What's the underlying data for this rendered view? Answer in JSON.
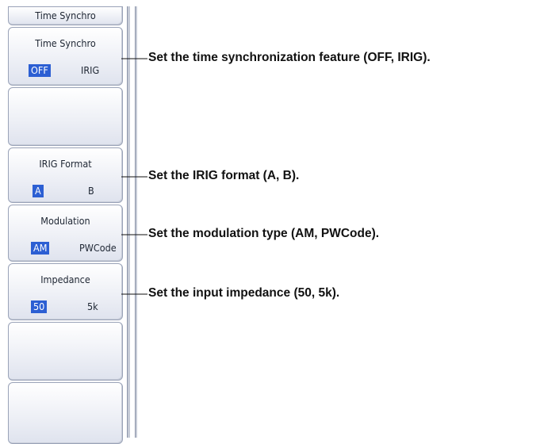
{
  "panel": {
    "header": "Time Synchro",
    "softkeys": [
      {
        "title": "Time Synchro",
        "options": [
          "OFF",
          "IRIG"
        ],
        "selected": 0
      },
      {
        "title": "",
        "options": []
      },
      {
        "title": "IRIG Format",
        "options": [
          "A",
          "B"
        ],
        "selected": 0
      },
      {
        "title": "Modulation",
        "options": [
          "AM",
          "PWCode"
        ],
        "selected": 0
      },
      {
        "title": "Impedance",
        "options": [
          "50",
          "5k"
        ],
        "selected": 0
      },
      {
        "title": "",
        "options": []
      },
      {
        "title": "",
        "options": []
      }
    ]
  },
  "callouts": [
    "Set the time synchronization feature (OFF, IRIG).",
    "Set the IRIG format (A, B).",
    "Set the modulation type (AM, PWCode).",
    "Set the input impedance (50, 5k)."
  ],
  "colors": {
    "selected_bg": "#2c5fd3",
    "border": "#9aa3b8"
  }
}
